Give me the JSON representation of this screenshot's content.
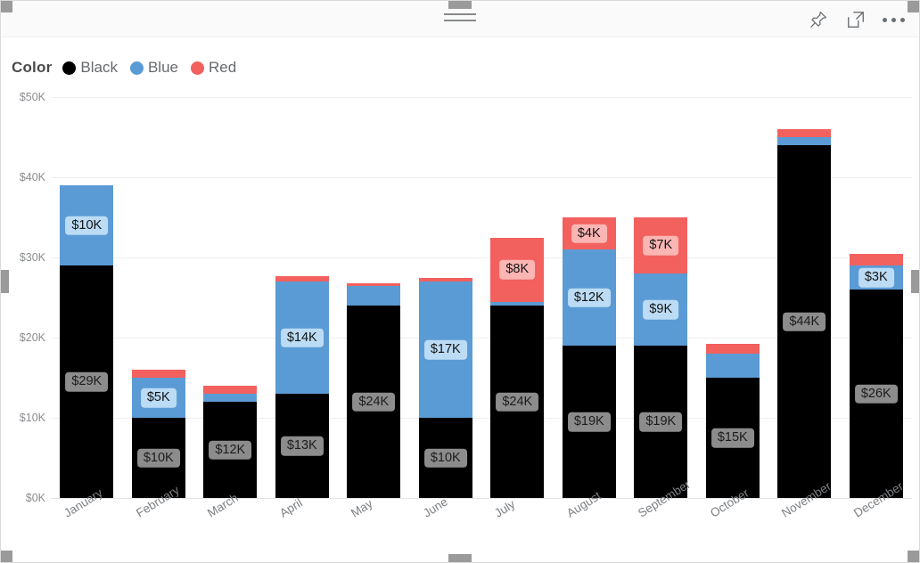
{
  "header": {
    "drag_handle_name": "drag-handle",
    "icons": [
      {
        "name": "pin-icon",
        "label": "Pin visual"
      },
      {
        "name": "focus-mode-icon",
        "label": "Focus mode"
      },
      {
        "name": "more-options-icon",
        "label": "More options"
      }
    ]
  },
  "legend": {
    "title": "Color",
    "items": [
      {
        "label": "Black",
        "color": "#000000"
      },
      {
        "label": "Blue",
        "color": "#5B9BD5"
      },
      {
        "label": "Red",
        "color": "#F2615E"
      }
    ]
  },
  "axis": {
    "y_ticks": [
      "$0K",
      "$10K",
      "$20K",
      "$30K",
      "$40K",
      "$50K"
    ],
    "y_min": 0,
    "y_max": 50000
  },
  "chart_data": {
    "type": "bar",
    "stacked": true,
    "title": "",
    "xlabel": "",
    "ylabel": "",
    "ylim": [
      0,
      50000
    ],
    "ytick_labels": [
      "$0K",
      "$10K",
      "$20K",
      "$30K",
      "$40K",
      "$50K"
    ],
    "grid": true,
    "legend_position": "top-left",
    "legend_title": "Color",
    "categories": [
      "January",
      "February",
      "March",
      "April",
      "May",
      "June",
      "July",
      "August",
      "September",
      "October",
      "November",
      "December"
    ],
    "series": [
      {
        "name": "Black",
        "color": "#000000",
        "values": [
          29000,
          10000,
          12000,
          13000,
          24000,
          10000,
          24000,
          19000,
          19000,
          15000,
          44000,
          26000
        ],
        "labels": [
          "$29K",
          "$10K",
          "$12K",
          "$13K",
          "$24K",
          "$10K",
          "$24K",
          "$19K",
          "$19K",
          "$15K",
          "$44K",
          "$26K"
        ]
      },
      {
        "name": "Blue",
        "color": "#5B9BD5",
        "values": [
          10000,
          5000,
          1000,
          14000,
          2500,
          17000,
          500,
          12000,
          9000,
          3000,
          1000,
          3000
        ],
        "labels": [
          "$10K",
          "$5K",
          "",
          "$14K",
          "",
          "$17K",
          "",
          "$12K",
          "$9K",
          "",
          "",
          "$3K"
        ]
      },
      {
        "name": "Red",
        "color": "#F2615E",
        "values": [
          0,
          1000,
          1000,
          700,
          300,
          400,
          8000,
          4000,
          7000,
          1200,
          1000,
          1500
        ],
        "labels": [
          "",
          "",
          "",
          "",
          "",
          "",
          "$8K",
          "$4K",
          "$7K",
          "",
          "",
          ""
        ]
      }
    ]
  }
}
